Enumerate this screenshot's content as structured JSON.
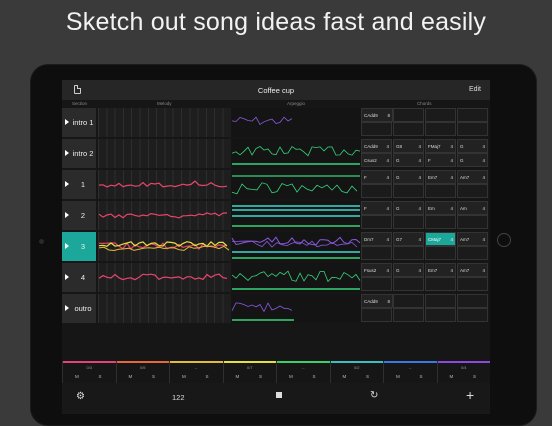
{
  "promo_text": "Sketch out song ideas fast and easily",
  "app": {
    "title": "Coffee cup",
    "edit_label": "Edit",
    "columns": [
      "Section",
      "Melody",
      "Arpeggio",
      "Chords"
    ],
    "tempo": "122"
  },
  "sections": [
    {
      "label": "intro 1",
      "active": false,
      "chords": [
        {
          "name": "CAdd9",
          "beats": "8"
        }
      ]
    },
    {
      "label": "intro 2",
      "active": false,
      "chords": [
        {
          "name": "CAdd9",
          "beats": "4"
        },
        {
          "name": "G8",
          "beats": "4"
        },
        {
          "name": "FMaj7",
          "beats": "4"
        },
        {
          "name": "G",
          "beats": "4"
        },
        {
          "name": "Csus2",
          "beats": "4"
        },
        {
          "name": "G",
          "beats": "4"
        },
        {
          "name": "F",
          "beats": "4"
        },
        {
          "name": "G",
          "beats": "4"
        }
      ]
    },
    {
      "label": "1",
      "active": false,
      "chords": [
        {
          "name": "F",
          "beats": "4"
        },
        {
          "name": "G",
          "beats": "4"
        },
        {
          "name": "Em7",
          "beats": "4"
        },
        {
          "name": "Am7",
          "beats": "4"
        }
      ]
    },
    {
      "label": "2",
      "active": false,
      "chords": [
        {
          "name": "F",
          "beats": "4"
        },
        {
          "name": "G",
          "beats": "4"
        },
        {
          "name": "Em",
          "beats": "4"
        },
        {
          "name": "Am",
          "beats": "4"
        }
      ]
    },
    {
      "label": "3",
      "active": true,
      "chords": [
        {
          "name": "Dm7",
          "beats": "4"
        },
        {
          "name": "G7",
          "beats": "4"
        },
        {
          "name": "CMaj7",
          "beats": "4"
        },
        {
          "name": "Am7",
          "beats": "4"
        }
      ]
    },
    {
      "label": "4",
      "active": false,
      "chords": [
        {
          "name": "Fsus2",
          "beats": "4"
        },
        {
          "name": "G",
          "beats": "4"
        },
        {
          "name": "Em7",
          "beats": "4"
        },
        {
          "name": "Am7",
          "beats": "4"
        }
      ]
    },
    {
      "label": "outro",
      "active": false,
      "chords": [
        {
          "name": "CAdd9",
          "beats": "8"
        }
      ]
    }
  ],
  "tracks": [
    {
      "value": "0/3",
      "color": "#e0457a"
    },
    {
      "value": "0/5",
      "color": "#e56a3a"
    },
    {
      "value": "--",
      "color": "#e5b93a"
    },
    {
      "value": "0/7",
      "color": "#e7e040"
    },
    {
      "value": "--",
      "color": "#3ad06a"
    },
    {
      "value": "0/2",
      "color": "#3ac0c0"
    },
    {
      "value": "--",
      "color": "#3a7ae0"
    },
    {
      "value": "0/4",
      "color": "#8a4ae0"
    }
  ],
  "mute_label": "M",
  "solo_label": "S",
  "colors": {
    "accent": "#1ba89a",
    "melody_line": "#e8456e",
    "arp_green": "#36d47a",
    "arp_purple": "#8a5ae0",
    "arp_cyan": "#40d8d0"
  },
  "icons": {
    "settings": "gear-icon",
    "stop": "stop-icon",
    "loop": "loop-icon",
    "add": "plus-icon",
    "document": "document-icon"
  }
}
